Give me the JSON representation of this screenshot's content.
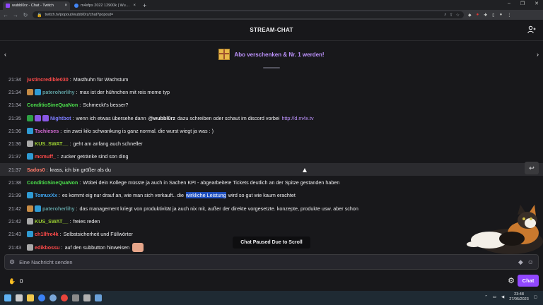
{
  "browser": {
    "tabs": [
      {
        "label": "wubbl0rz - Chat - Twitch",
        "active": true
      },
      {
        "label": "m4xfps 2022 12900k | Wunschli...",
        "active": false
      }
    ],
    "new_tab": "+",
    "url": "twitch.tv/popout/wubbl0rz/chat?popout=",
    "window_controls": [
      "–",
      "❐",
      "✕"
    ]
  },
  "header": {
    "title": "STREAM-CHAT"
  },
  "promo": {
    "text": "Abo verschenken & Nr. 1 werden!",
    "left_arrow": "‹",
    "right_arrow": "›"
  },
  "messages": [
    {
      "time": "21:34",
      "badges": [],
      "user": "justincredible030",
      "color": "#ff4a4a",
      "text": "Masthuhn für Wachstum"
    },
    {
      "time": "21:34",
      "badges": [
        "#c68b45",
        "#2f9bd4"
      ],
      "user": "pateroherlihy",
      "color": "#5f9ea0",
      "text": "max ist der hühnchen mit reis meme typ"
    },
    {
      "time": "21:34",
      "badges": [],
      "user": "ConditioSineQuaNon",
      "color": "#4ce04c",
      "text": "Schmeckt's besser?"
    },
    {
      "time": "21:35",
      "badges": [
        "#2ea043",
        "#8957e5",
        "#8957e5"
      ],
      "user": "Nightbot",
      "color": "#7c7cff",
      "text_before": "wenn ich etwas übersehe dann",
      "mention": "@wubbl0rz",
      "text_middle": "dazu schreiben oder schaut im discord vorbei",
      "link": "http://d.m4x.tv"
    },
    {
      "time": "21:36",
      "badges": [
        "#2f9bd4"
      ],
      "user": "Tschieses",
      "color": "#d66bd6",
      "text": "ein zwei kilo schwankung is ganz normal. die wurst wiegt ja was : )"
    },
    {
      "time": "21:36",
      "badges": [
        "#aaaaaa"
      ],
      "user": "KUS_SWAT__",
      "color": "#9acd32",
      "text": "geht am anfang auch schneller"
    },
    {
      "time": "21:37",
      "badges": [
        "#2f9bd4"
      ],
      "user": "mcmuff_",
      "color": "#ff4a4a",
      "text": "zucker getränke sind son ding"
    },
    {
      "time": "21:37",
      "badges": [],
      "user": "Sados0",
      "color": "#ff7a6a",
      "text": "krass, ich bin größer als du",
      "highlight": true
    },
    {
      "time": "21:38",
      "badges": [],
      "user": "ConditioSineQuaNon",
      "color": "#4ce04c",
      "text": "Wobei dein Kollege müsste ja auch in Sachen KPI - abgearbeitete Tickets deutlich an der Spitze gestanden haben"
    },
    {
      "time": "21:39",
      "badges": [
        "#2f9bd4"
      ],
      "user": "TomuxXx",
      "color": "#3fa9f5",
      "text_before": "es kommt eig nur drauf an, wie man sich verkauft.. die",
      "selected": "wirkliche Leistung",
      "text_after": "wird so gut wie kaum erachtet"
    },
    {
      "time": "21:42",
      "badges": [
        "#c68b45",
        "#2f9bd4"
      ],
      "user": "pateroherlihy",
      "color": "#5f9ea0",
      "text": "das management kriegt von produktivität ja auch nix mit, außer der direkte vorgesetzte. konzepte, produkte usw. aber schon"
    },
    {
      "time": "21:42",
      "badges": [
        "#aaaaaa"
      ],
      "user": "KUS_SWAT__",
      "color": "#9acd32",
      "text": "freies reden"
    },
    {
      "time": "21:43",
      "badges": [
        "#2f9bd4"
      ],
      "user": "ch1llfre4k",
      "color": "#ff4a4a",
      "text": "Selbstsicherheit und Füllwörter"
    },
    {
      "time": "21:43",
      "badges": [
        "#aaaaaa"
      ],
      "user": "edikbossu",
      "color": "#ff4a4a",
      "text": "auf den subbutton hinweisen",
      "emote": true
    }
  ],
  "paused_notice": "Chat Paused Due to Scroll",
  "input": {
    "placeholder": "Eine Nachricht senden"
  },
  "bottom": {
    "points": "0",
    "chat_button": "Chat"
  },
  "taskbar": {
    "time": "23:48",
    "date": "27/05/2023"
  },
  "colors": {
    "accent": "#9147ff",
    "promo_text": "#bf94ff",
    "background": "#18181b"
  }
}
